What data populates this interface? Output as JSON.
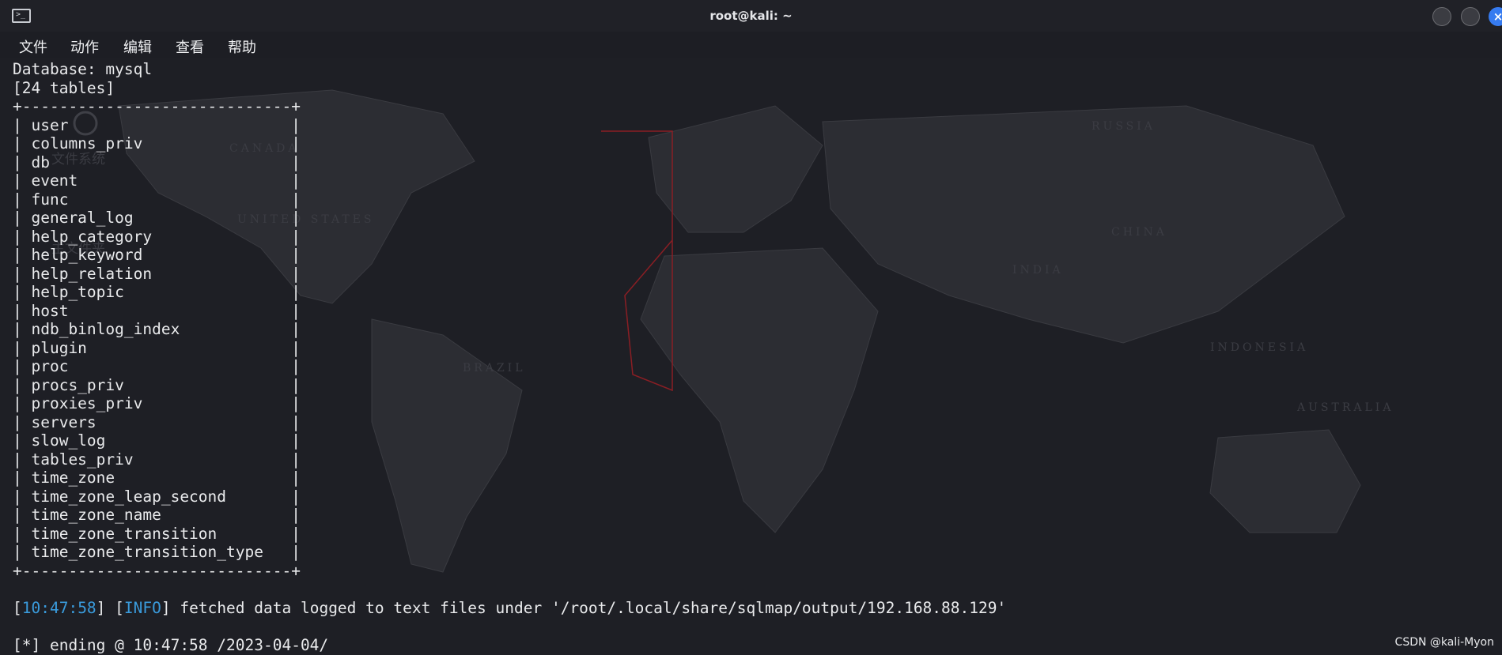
{
  "window": {
    "title": "root@kali: ~",
    "close_glyph": "×"
  },
  "menu": [
    "文件",
    "动作",
    "编辑",
    "查看",
    "帮助"
  ],
  "terminal": {
    "database_line": "Database: mysql",
    "count_line": "[24 tables]",
    "border": "+-----------------------------+",
    "tables": [
      "user",
      "columns_priv",
      "db",
      "event",
      "func",
      "general_log",
      "help_category",
      "help_keyword",
      "help_relation",
      "help_topic",
      "host",
      "ndb_binlog_index",
      "plugin",
      "proc",
      "procs_priv",
      "proxies_priv",
      "servers",
      "slow_log",
      "tables_priv",
      "time_zone",
      "time_zone_leap_second",
      "time_zone_name",
      "time_zone_transition",
      "time_zone_transition_type"
    ],
    "log_open": "[",
    "log_time": "10:47:58",
    "log_mid": "] [",
    "log_level": "INFO",
    "log_text": "] fetched data logged to text files under '/root/.local/share/sqlmap/output/192.168.88.129'",
    "ending_line": "[*] ending @ 10:47:58 /2023-04-04/"
  },
  "map_labels": {
    "canada": "CANADA",
    "usa": "UNITED STATES",
    "russia": "RUSSIA",
    "china": "CHINA",
    "india": "INDIA",
    "brazil": "BRAZIL",
    "australia": "AUSTRALIA",
    "indonesia": "INDONESIA"
  },
  "desktop_icon_labels": {
    "filesystem": "文件系统",
    "home": "主文件夹"
  },
  "watermark": "CSDN @kali-Myon"
}
